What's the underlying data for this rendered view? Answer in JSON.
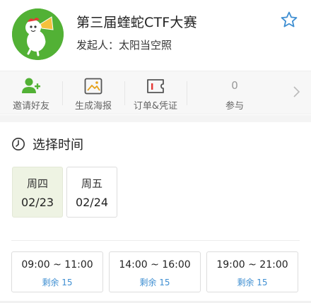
{
  "header": {
    "title": "第三届蝰蛇CTF大赛",
    "organizer": "发起人：太阳当空照"
  },
  "actions": [
    {
      "label": "邀请好友",
      "icon": "add-user-icon"
    },
    {
      "label": "生成海报",
      "icon": "image-icon"
    },
    {
      "label": "订单&凭证",
      "icon": "ticket-icon"
    },
    {
      "label": "参与",
      "count": "0"
    }
  ],
  "section": {
    "title": "选择时间"
  },
  "dates": [
    {
      "weekday": "周四",
      "date": "02/23",
      "selected": true
    },
    {
      "weekday": "周五",
      "date": "02/24",
      "selected": false
    }
  ],
  "slots": [
    {
      "time": "09:00 ~ 11:00",
      "remaining": "剩余 15"
    },
    {
      "time": "14:00 ~ 16:00",
      "remaining": "剩余 15"
    },
    {
      "time": "19:00 ~ 21:00",
      "remaining": "剩余 15"
    }
  ],
  "colors": {
    "brand_green": "#52b135",
    "accent_blue": "#3f8fd2",
    "selected_date_bg": "#eef3e3"
  }
}
